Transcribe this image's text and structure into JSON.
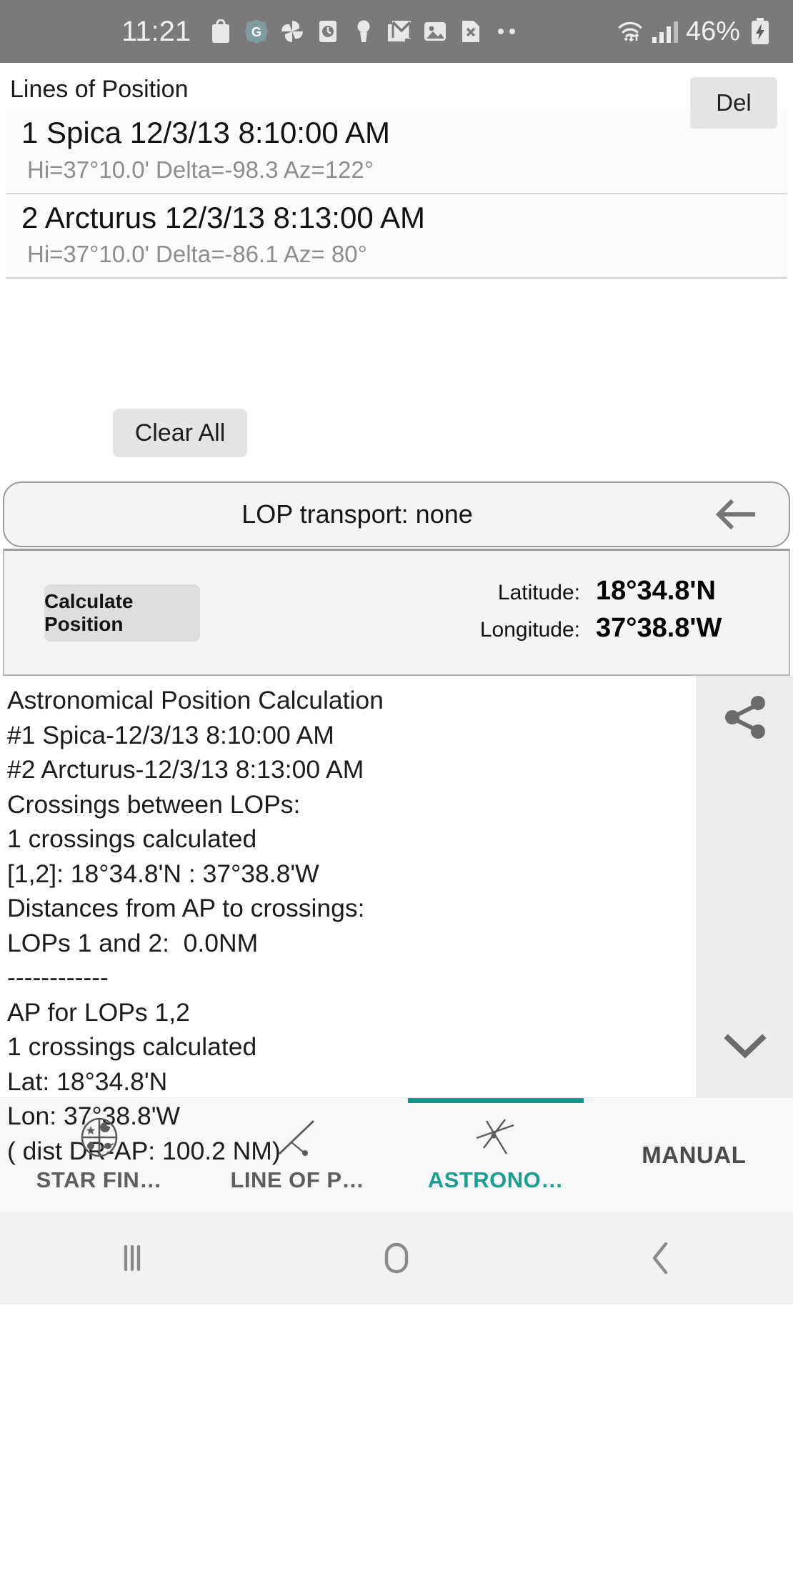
{
  "status_bar": {
    "time": "11:21",
    "icons": [
      "bag-icon",
      "google-icon",
      "pinwheel-icon",
      "clock-icon",
      "keyhole-icon",
      "gmail-icon",
      "photos-icon",
      "x-file-icon",
      "more-dots-icon"
    ],
    "wifi": "wifi-icon",
    "signal": "signal-bars-icon",
    "battery_percent": "46%",
    "battery": "battery-charging-icon"
  },
  "lop_section": {
    "title": "Lines of Position",
    "delete_label": "Del",
    "items": [
      {
        "main": "1 Spica 12/3/13 8:10:00 AM",
        "sub": "Hi=37°10.0'  Delta=-98.3 Az=122°"
      },
      {
        "main": "2 Arcturus 12/3/13 8:13:00 AM",
        "sub": "Hi=37°10.0'  Delta=-86.1 Az= 80°"
      }
    ],
    "clear_all_label": "Clear All"
  },
  "transport": {
    "label": "LOP transport: none",
    "back_icon": "arrow-left-icon"
  },
  "calculation": {
    "button_label": "Calculate Position",
    "latitude_label": "Latitude:",
    "latitude_value": "18°34.8'N",
    "longitude_label": "Longitude:",
    "longitude_value": "37°38.8'W"
  },
  "output": {
    "text": "Astronomical Position Calculation\n#1 Spica-12/3/13 8:10:00 AM\n#2 Arcturus-12/3/13 8:13:00 AM\nCrossings between LOPs:\n1 crossings calculated\n[1,2]: 18°34.8'N : 37°38.8'W\nDistances from AP to crossings:\nLOPs 1 and 2:  0.0NM\n------------\nAP for LOPs 1,2\n1 crossings calculated\nLat: 18°34.8'N\nLon: 37°38.8'W\n( dist DR-AP: 100.2 NM)",
    "share_icon": "share-icon",
    "expand_icon": "chevron-down-icon"
  },
  "tabs": [
    {
      "label": "STAR FIN…",
      "icon": "star-finder-icon",
      "active": false
    },
    {
      "label": "LINE OF P…",
      "icon": "line-of-position-icon",
      "active": false
    },
    {
      "label": "ASTRONO…",
      "icon": "astronomical-fix-icon",
      "active": true
    },
    {
      "label": "MANUAL",
      "icon": "none",
      "active": false
    }
  ],
  "nav_bar": {
    "recents": "recents-icon",
    "home": "home-icon",
    "back": "back-icon"
  },
  "colors": {
    "accent": "#0f9488",
    "status_bar_bg": "#7a7a7a",
    "panel_bg": "#f4f4f4",
    "button_bg": "#e4e4e4"
  }
}
